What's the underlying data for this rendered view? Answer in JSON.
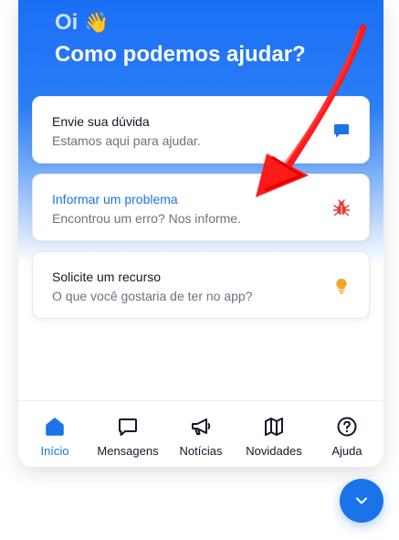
{
  "hero": {
    "greeting": "Oi",
    "greeting_emoji": "👋",
    "headline": "Como podemos ajudar?"
  },
  "cards": [
    {
      "title": "Envie sua dúvida",
      "subtitle": "Estamos aqui para ajudar.",
      "icon": "chat-bubble-icon",
      "icon_color": "#1a73e8"
    },
    {
      "title": "Informar um problema",
      "subtitle": "Encontrou um erro? Nos informe.",
      "icon": "bug-icon",
      "icon_color": "#e53935",
      "highlighted": true
    },
    {
      "title": "Solicite um recurso",
      "subtitle": "O que você gostaria de ter no app?",
      "icon": "lightbulb-icon",
      "icon_color": "#f5a623"
    }
  ],
  "nav": {
    "items": [
      {
        "label": "Início",
        "icon": "home-icon",
        "active": true
      },
      {
        "label": "Mensagens",
        "icon": "message-icon"
      },
      {
        "label": "Notícias",
        "icon": "megaphone-icon"
      },
      {
        "label": "Novidades",
        "icon": "map-icon"
      },
      {
        "label": "Ajuda",
        "icon": "help-circle-icon"
      }
    ]
  },
  "fab": {
    "icon": "chevron-down-icon"
  },
  "colors": {
    "accent": "#1a73e8",
    "hero_top": "#1a6ff5",
    "annotation": "#ff1a1a"
  }
}
